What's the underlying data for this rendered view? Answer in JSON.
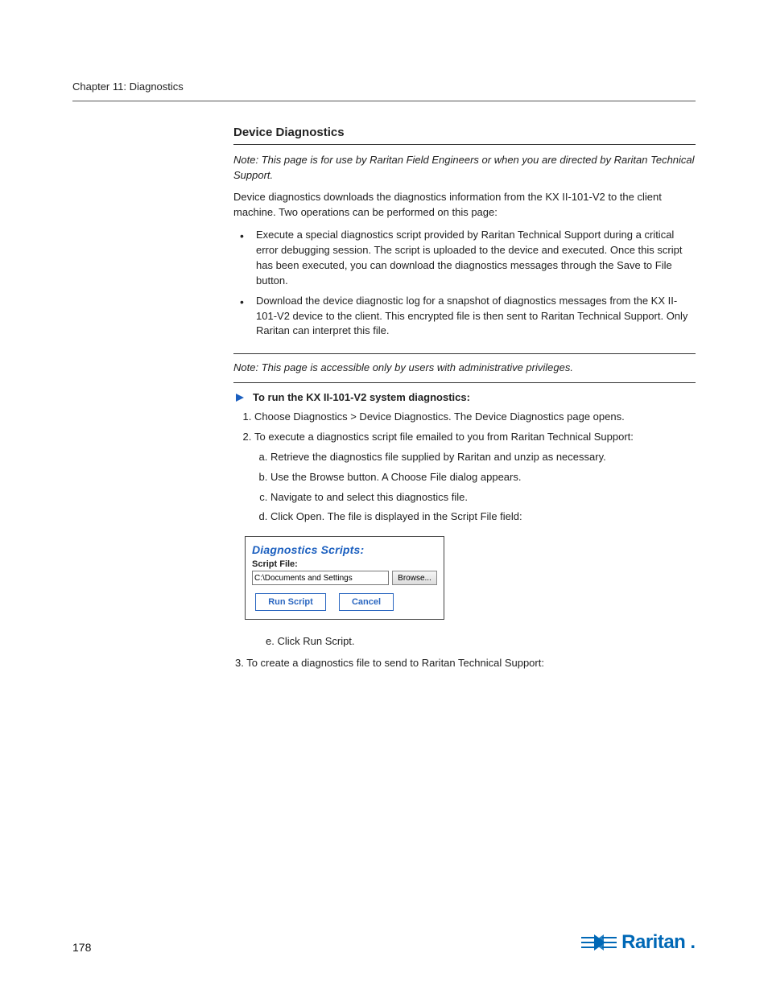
{
  "header": {
    "chapter_line": "Chapter 11: Diagnostics"
  },
  "section1": {
    "title": "Device Diagnostics",
    "note": "Note: This page is for use by Raritan Field Engineers or when you are directed by Raritan Technical Support.",
    "intro": "Device diagnostics downloads the diagnostics information from the KX II-101-V2 to the client machine. Two operations can be performed on this page:",
    "bullets": [
      "Execute a special diagnostics script provided by Raritan Technical Support during a critical error debugging session. The script is uploaded to the device and executed. Once this script has been executed, you can download the diagnostics messages through the Save to File button.",
      "Download the device diagnostic log for a snapshot of diagnostics messages from the KX II-101-V2 device to the client. This encrypted file is then sent to Raritan Technical Support. Only Raritan can interpret this file."
    ],
    "note2": "Note: This page is accessible only by users with administrative privileges."
  },
  "steps": {
    "lead": "To run the KX II-101-V2 system diagnostics:",
    "items": [
      "Choose Diagnostics > Device Diagnostics. The Device Diagnostics page opens.",
      "To execute a diagnostics script file emailed to you from Raritan Technical Support:",
      {
        "a": "Retrieve the diagnostics file supplied by Raritan and unzip as necessary.",
        "b": "Use the Browse button. A Choose File dialog appears.",
        "c": "Navigate to and select this diagnostics file.",
        "d": "Click Open. The file is displayed in the Script File field:"
      }
    ],
    "e": "e.  Click Run Script.",
    "three": "3.  To create a diagnostics file to send to Raritan Technical Support:"
  },
  "dialog": {
    "title": "Diagnostics Scripts:",
    "label": "Script File:",
    "input_value": "C:\\Documents and Settings",
    "browse": "Browse...",
    "run": "Run Script",
    "cancel": "Cancel"
  },
  "footer": {
    "page": "178",
    "brand": "Raritan"
  }
}
